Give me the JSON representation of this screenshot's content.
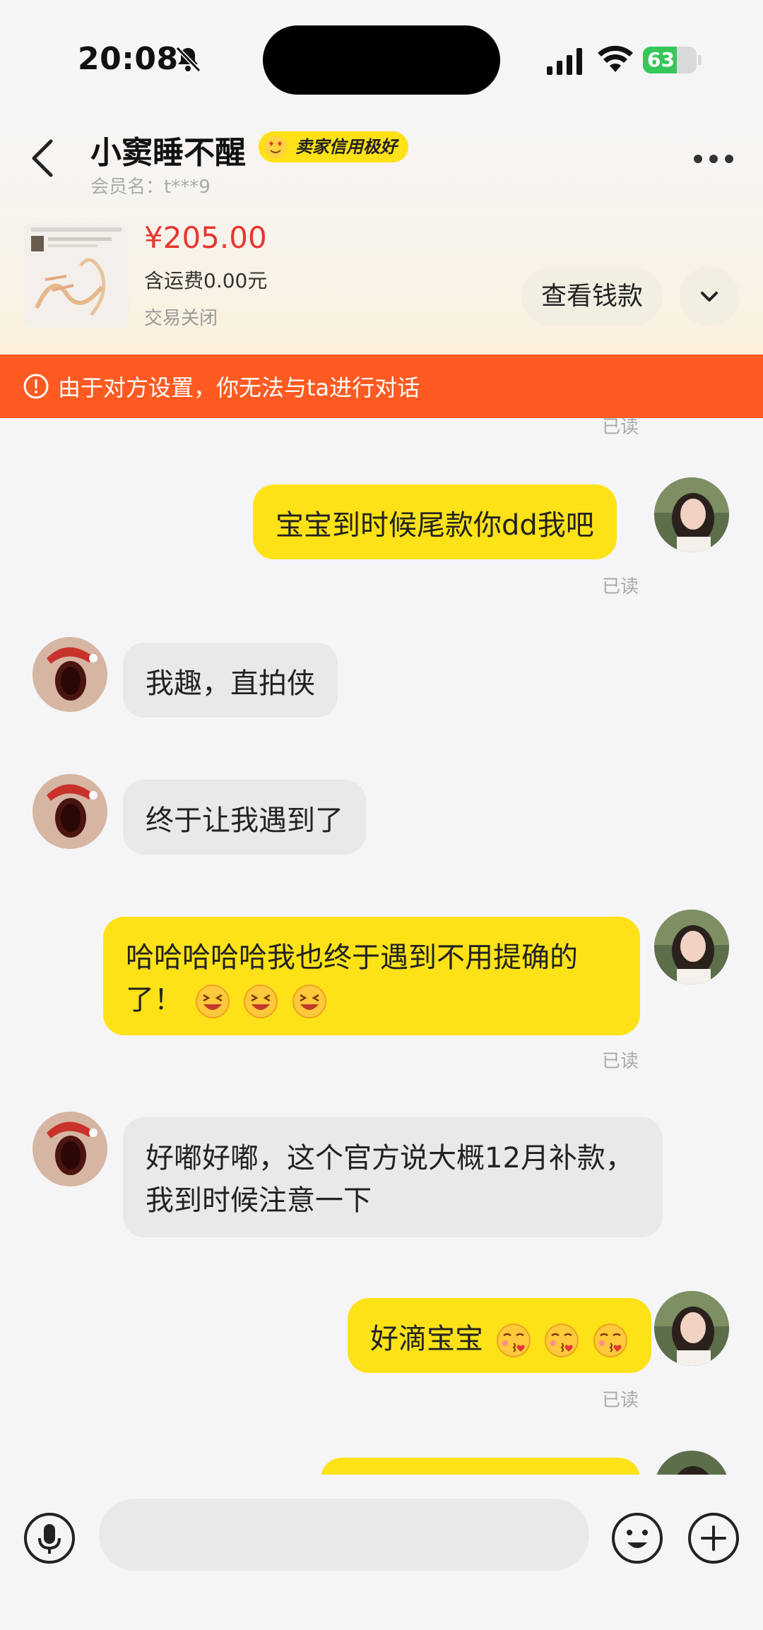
{
  "status_bar": {
    "time": "20:08",
    "battery": "63",
    "battery_level": 0.63
  },
  "header": {
    "title": "小窦睡不醒",
    "badge": "卖家信用极好",
    "member": "会员名：t***9"
  },
  "order": {
    "price": "¥205.00",
    "shipping": "含运费0.00元",
    "status": "交易关闭",
    "view_button": "查看钱款"
  },
  "banner": {
    "text": "由于对方设置，你无法与ta进行对话"
  },
  "messages": [
    {
      "from": "me",
      "text": "宝宝到时候尾款你dd我吧",
      "read": "已读"
    },
    {
      "from": "them",
      "text": "我趣，直拍侠"
    },
    {
      "from": "them",
      "text": "终于让我遇到了"
    },
    {
      "from": "me",
      "text": "哈哈哈哈哈我也终于遇到不用提确的了！",
      "emojis": [
        "grin-squint-icon",
        "grin-squint-icon",
        "grin-squint-icon"
      ],
      "read": "已读"
    },
    {
      "from": "them",
      "text": "好嘟好嘟，这个官方说大概12月补款，我到时候注意一下"
    },
    {
      "from": "me",
      "text": "好滴宝宝",
      "emojis": [
        "kiss-heart-icon",
        "kiss-heart-icon",
        "kiss-heart-icon"
      ],
      "read": "已读"
    }
  ],
  "top_read_label": "已读",
  "colors": {
    "accent": "#fce217",
    "price": "#e8362e",
    "banner": "#fe5a21",
    "them_bubble": "#e9e9eb"
  }
}
